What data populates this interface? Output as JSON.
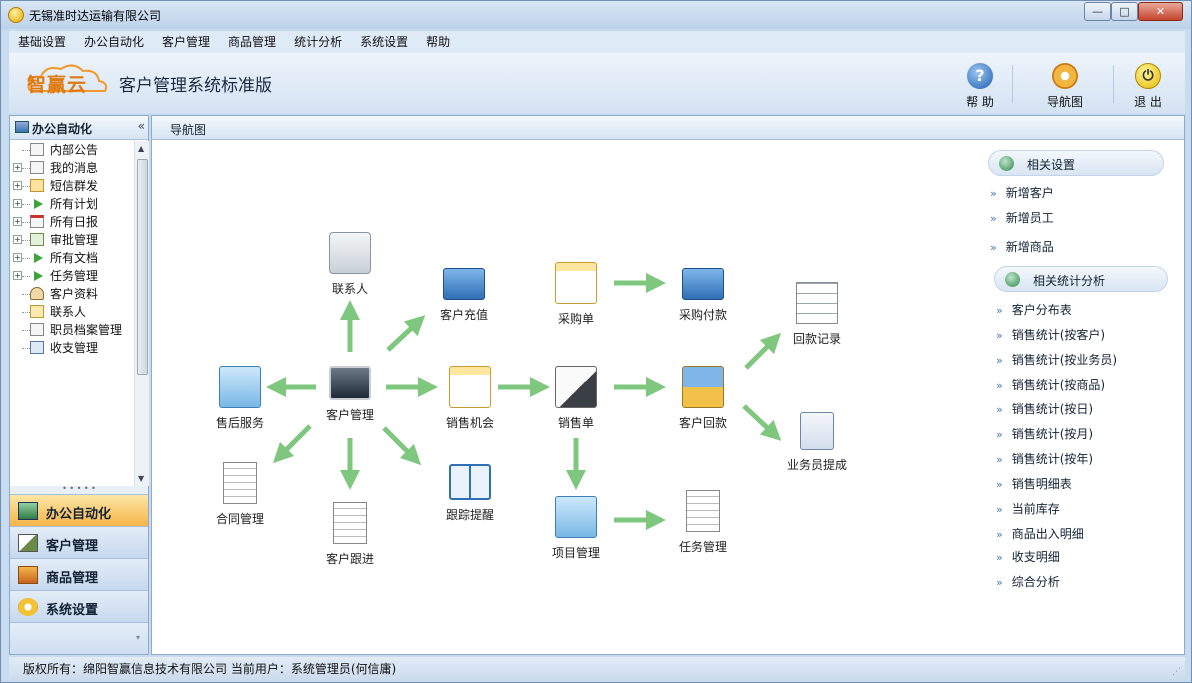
{
  "window": {
    "title": "无锡准时达运输有限公司"
  },
  "menu": [
    "基础设置",
    "办公自动化",
    "客户管理",
    "商品管理",
    "统计分析",
    "系统设置",
    "帮助"
  ],
  "header": {
    "logo_text": "智赢云",
    "system_title": "客户管理系统标准版"
  },
  "toolbar": [
    {
      "label": "帮 助",
      "icon": "help-icon"
    },
    {
      "label": "导航图",
      "icon": "navigation-gear-icon"
    },
    {
      "label": "退 出",
      "icon": "power-icon"
    }
  ],
  "left_panel": {
    "title": "办公自动化",
    "tree": [
      {
        "label": "内部公告",
        "expandable": false
      },
      {
        "label": "我的消息",
        "expandable": true
      },
      {
        "label": "短信群发",
        "expandable": true
      },
      {
        "label": "所有计划",
        "expandable": true
      },
      {
        "label": "所有日报",
        "expandable": true
      },
      {
        "label": "审批管理",
        "expandable": true
      },
      {
        "label": "所有文档",
        "expandable": true
      },
      {
        "label": "任务管理",
        "expandable": true
      },
      {
        "label": "客户资料",
        "expandable": false
      },
      {
        "label": "联系人",
        "expandable": false
      },
      {
        "label": "职员档案管理",
        "expandable": false
      },
      {
        "label": "收支管理",
        "expandable": false
      }
    ],
    "categories": [
      {
        "label": "办公自动化",
        "active": true
      },
      {
        "label": "客户管理",
        "active": false
      },
      {
        "label": "商品管理",
        "active": false
      },
      {
        "label": "系统设置",
        "active": false
      }
    ]
  },
  "main": {
    "tab": "导航图",
    "nodes": {
      "contact": "联系人",
      "customer_recharge": "客户充值",
      "purchase_order": "采购单",
      "purchase_payment": "采购付款",
      "payment_record": "回款记录",
      "after_sales": "售后服务",
      "customer_management": "客户管理",
      "sales_opportunity": "销售机会",
      "sales_order": "销售单",
      "customer_payment": "客户回款",
      "salesman_commission": "业务员提成",
      "contract_management": "合同管理",
      "customer_followup": "客户跟进",
      "tracking_reminder": "跟踪提醒",
      "project_management": "项目管理",
      "task_management": "任务管理"
    },
    "related_settings": {
      "title": "相关设置",
      "links": [
        "新增客户",
        "新增员工",
        "新增商品"
      ]
    },
    "related_stats": {
      "title": "相关统计分析",
      "links": [
        "客户分布表",
        "销售统计(按客户)",
        "销售统计(按业务员)",
        "销售统计(按商品)",
        "销售统计(按日)",
        "销售统计(按月)",
        "销售统计(按年)",
        "销售明细表",
        "当前库存",
        "商品出入明细",
        "收支明细",
        "综合分析"
      ]
    }
  },
  "status": {
    "text": "版权所有：绵阳智赢信息技术有限公司    当前用户：系统管理员(何信庸)"
  },
  "colors": {
    "arrow": "#7fc77f",
    "accent_orange": "#f5b44a",
    "frame_blue": "#c9dbee"
  }
}
